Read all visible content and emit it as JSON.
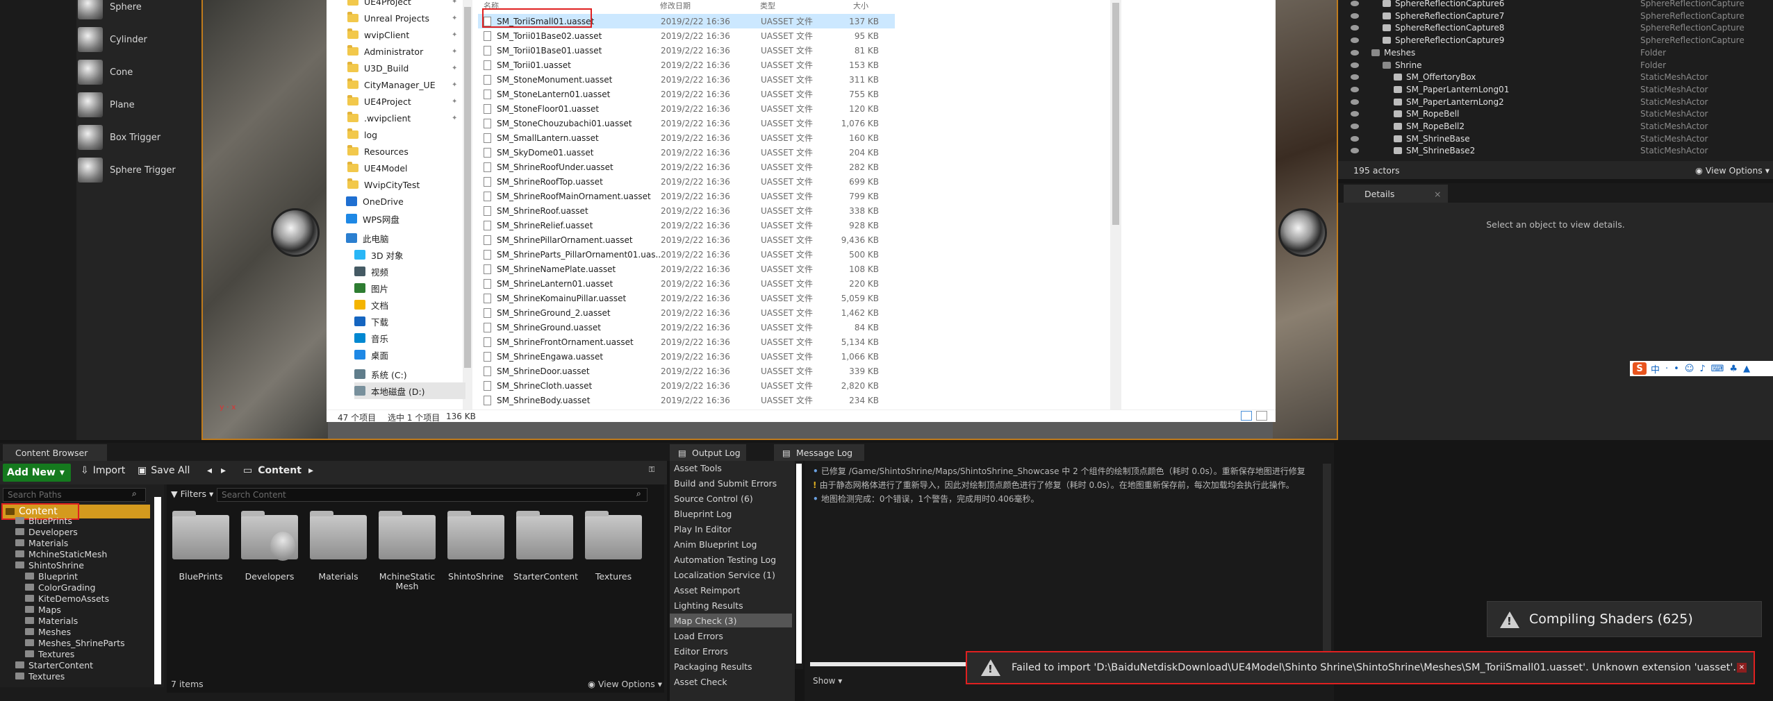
{
  "place_actors": {
    "items": [
      {
        "label": "Sphere",
        "icon": "sphere-icon"
      },
      {
        "label": "Cylinder",
        "icon": "cylinder-icon"
      },
      {
        "label": "Cone",
        "icon": "cone-icon"
      },
      {
        "label": "Plane",
        "icon": "plane-icon"
      },
      {
        "label": "Box Trigger",
        "icon": "box-trigger-icon"
      },
      {
        "label": "Sphere Trigger",
        "icon": "sphere-trigger-icon"
      }
    ]
  },
  "explorer": {
    "nav": [
      {
        "label": "UE4Project",
        "pin": true
      },
      {
        "label": "Unreal Projects",
        "pin": true
      },
      {
        "label": "wvipClient",
        "pin": true
      },
      {
        "label": "Administrator",
        "pin": true
      },
      {
        "label": "U3D_Build",
        "pin": true
      },
      {
        "label": "CityManager_UE",
        "pin": true
      },
      {
        "label": "UE4Project",
        "pin": true
      },
      {
        "label": ".wvipclient",
        "pin": true
      },
      {
        "label": "log",
        "pin": false
      },
      {
        "label": "Resources",
        "pin": false
      },
      {
        "label": "UE4Model",
        "pin": false
      },
      {
        "label": "WvipCityTest",
        "pin": false
      }
    ],
    "nav_special": [
      "OneDrive",
      "WPS网盘",
      "此电脑",
      "3D 对象",
      "视频",
      "图片",
      "文档",
      "下载",
      "音乐",
      "桌面",
      "系统 (C:)",
      "本地磁盘 (D:)"
    ],
    "headers": {
      "name": "名称",
      "date": "修改日期",
      "type": "类型",
      "size": "大小"
    },
    "files": [
      {
        "name": "SM_ToriiSmall01.uasset",
        "date": "2019/2/22 16:36",
        "type": "UASSET 文件",
        "size": "137 KB"
      },
      {
        "name": "SM_Torii01Base02.uasset",
        "date": "2019/2/22 16:36",
        "type": "UASSET 文件",
        "size": "95 KB"
      },
      {
        "name": "SM_Torii01Base01.uasset",
        "date": "2019/2/22 16:36",
        "type": "UASSET 文件",
        "size": "81 KB"
      },
      {
        "name": "SM_Torii01.uasset",
        "date": "2019/2/22 16:36",
        "type": "UASSET 文件",
        "size": "153 KB"
      },
      {
        "name": "SM_StoneMonument.uasset",
        "date": "2019/2/22 16:36",
        "type": "UASSET 文件",
        "size": "311 KB"
      },
      {
        "name": "SM_StoneLantern01.uasset",
        "date": "2019/2/22 16:36",
        "type": "UASSET 文件",
        "size": "755 KB"
      },
      {
        "name": "SM_StoneFloor01.uasset",
        "date": "2019/2/22 16:36",
        "type": "UASSET 文件",
        "size": "120 KB"
      },
      {
        "name": "SM_StoneChouzubachi01.uasset",
        "date": "2019/2/22 16:36",
        "type": "UASSET 文件",
        "size": "1,076 KB"
      },
      {
        "name": "SM_SmallLantern.uasset",
        "date": "2019/2/22 16:36",
        "type": "UASSET 文件",
        "size": "160 KB"
      },
      {
        "name": "SM_SkyDome01.uasset",
        "date": "2019/2/22 16:36",
        "type": "UASSET 文件",
        "size": "204 KB"
      },
      {
        "name": "SM_ShrineRoofUnder.uasset",
        "date": "2019/2/22 16:36",
        "type": "UASSET 文件",
        "size": "282 KB"
      },
      {
        "name": "SM_ShrineRoofTop.uasset",
        "date": "2019/2/22 16:36",
        "type": "UASSET 文件",
        "size": "699 KB"
      },
      {
        "name": "SM_ShrineRoofMainOrnament.uasset",
        "date": "2019/2/22 16:36",
        "type": "UASSET 文件",
        "size": "799 KB"
      },
      {
        "name": "SM_ShrineRoof.uasset",
        "date": "2019/2/22 16:36",
        "type": "UASSET 文件",
        "size": "338 KB"
      },
      {
        "name": "SM_ShrineRelief.uasset",
        "date": "2019/2/22 16:36",
        "type": "UASSET 文件",
        "size": "928 KB"
      },
      {
        "name": "SM_ShrinePillarOrnament.uasset",
        "date": "2019/2/22 16:36",
        "type": "UASSET 文件",
        "size": "9,436 KB"
      },
      {
        "name": "SM_ShrineParts_PillarOrnament01.uas...",
        "date": "2019/2/22 16:36",
        "type": "UASSET 文件",
        "size": "500 KB"
      },
      {
        "name": "SM_ShrineNamePlate.uasset",
        "date": "2019/2/22 16:36",
        "type": "UASSET 文件",
        "size": "108 KB"
      },
      {
        "name": "SM_ShrineLantern01.uasset",
        "date": "2019/2/22 16:36",
        "type": "UASSET 文件",
        "size": "220 KB"
      },
      {
        "name": "SM_ShrineKomainuPillar.uasset",
        "date": "2019/2/22 16:36",
        "type": "UASSET 文件",
        "size": "5,059 KB"
      },
      {
        "name": "SM_ShrineGround_2.uasset",
        "date": "2019/2/22 16:36",
        "type": "UASSET 文件",
        "size": "1,462 KB"
      },
      {
        "name": "SM_ShrineGround.uasset",
        "date": "2019/2/22 16:36",
        "type": "UASSET 文件",
        "size": "84 KB"
      },
      {
        "name": "SM_ShrineFrontOrnament.uasset",
        "date": "2019/2/22 16:36",
        "type": "UASSET 文件",
        "size": "5,134 KB"
      },
      {
        "name": "SM_ShrineEngawa.uasset",
        "date": "2019/2/22 16:36",
        "type": "UASSET 文件",
        "size": "1,066 KB"
      },
      {
        "name": "SM_ShrineDoor.uasset",
        "date": "2019/2/22 16:36",
        "type": "UASSET 文件",
        "size": "339 KB"
      },
      {
        "name": "SM_ShrineCloth.uasset",
        "date": "2019/2/22 16:36",
        "type": "UASSET 文件",
        "size": "2,820 KB"
      },
      {
        "name": "SM_ShrineBody.uasset",
        "date": "2019/2/22 16:36",
        "type": "UASSET 文件",
        "size": "234 KB"
      }
    ],
    "status": {
      "count": "47 个项目",
      "selected": "选中 1 个项目",
      "size": "136 KB"
    }
  },
  "outliner": {
    "rows": [
      {
        "name": "SphereReflectionCapture6",
        "type": "SphereReflectionCapture",
        "indent": 3
      },
      {
        "name": "SphereReflectionCapture7",
        "type": "SphereReflectionCapture",
        "indent": 3
      },
      {
        "name": "SphereReflectionCapture8",
        "type": "SphereReflectionCapture",
        "indent": 3
      },
      {
        "name": "SphereReflectionCapture9",
        "type": "SphereReflectionCapture",
        "indent": 3
      },
      {
        "name": "Meshes",
        "type": "Folder",
        "indent": 2
      },
      {
        "name": "Shrine",
        "type": "Folder",
        "indent": 3
      },
      {
        "name": "SM_OffertoryBox",
        "type": "StaticMeshActor",
        "indent": 4
      },
      {
        "name": "SM_PaperLanternLong01",
        "type": "StaticMeshActor",
        "indent": 4
      },
      {
        "name": "SM_PaperLanternLong2",
        "type": "StaticMeshActor",
        "indent": 4
      },
      {
        "name": "SM_RopeBell",
        "type": "StaticMeshActor",
        "indent": 4
      },
      {
        "name": "SM_RopeBell2",
        "type": "StaticMeshActor",
        "indent": 4
      },
      {
        "name": "SM_ShrineBase",
        "type": "StaticMeshActor",
        "indent": 4
      },
      {
        "name": "SM_ShrineBase2",
        "type": "StaticMeshActor",
        "indent": 4
      }
    ],
    "actor_count": "195 actors",
    "view_options": "View Options"
  },
  "details": {
    "tab": "Details",
    "empty_text": "Select an object to view details."
  },
  "content_browser": {
    "tab": "Content Browser",
    "add_new": "Add New",
    "import": "Import",
    "save_all": "Save All",
    "breadcrumb": "Content",
    "search_paths": "Search Paths",
    "filters": "Filters",
    "search_content": "Search Content",
    "tree": [
      {
        "label": "Content",
        "level": 0
      },
      {
        "label": "BluePrints",
        "level": 1
      },
      {
        "label": "Developers",
        "level": 1
      },
      {
        "label": "Materials",
        "level": 1
      },
      {
        "label": "MchineStaticMesh",
        "level": 1
      },
      {
        "label": "ShintoShrine",
        "level": 1
      },
      {
        "label": "Blueprint",
        "level": 2
      },
      {
        "label": "ColorGrading",
        "level": 2
      },
      {
        "label": "KiteDemoAssets",
        "level": 2
      },
      {
        "label": "Maps",
        "level": 2
      },
      {
        "label": "Materials",
        "level": 2
      },
      {
        "label": "Meshes",
        "level": 2
      },
      {
        "label": "Meshes_ShrineParts",
        "level": 2
      },
      {
        "label": "Textures",
        "level": 2
      },
      {
        "label": "StarterContent",
        "level": 1
      },
      {
        "label": "Textures",
        "level": 1
      }
    ],
    "assets": [
      "BluePrints",
      "Developers",
      "Materials",
      "MchineStatic\nMesh",
      "ShintoShrine",
      "StarterContent",
      "Textures"
    ],
    "item_count": "7 items",
    "view_options": "View Options"
  },
  "log": {
    "tabs": [
      "Output Log",
      "Message Log"
    ],
    "categories": [
      "Asset Tools",
      "Build and Submit Errors",
      "Source Control (6)",
      "Blueprint Log",
      "Play In Editor",
      "Anim Blueprint Log",
      "Automation Testing Log",
      "Localization Service (1)",
      "Asset Reimport",
      "Lighting Results",
      "Map Check (3)",
      "Load Errors",
      "Editor Errors",
      "Packaging Results",
      "Asset Check"
    ],
    "selected_category": "Map Check (3)",
    "lines": [
      {
        "level": "info",
        "text": "已修复 /Game/ShintoShrine/Maps/ShintoShrine_Showcase 中 2 个组件的绘制顶点颜色（耗时 0.0s）。重新保存地图进行修复"
      },
      {
        "level": "warning",
        "text": "由于静态网格体进行了重新导入，因此对绘制顶点颜色进行了修复（耗时 0.0s）。在地图重新保存前，每次加载均会执行此操作。"
      },
      {
        "level": "info",
        "text": "地图检测完成：0个错误，1个警告，完成用时0.406毫秒。"
      }
    ],
    "show": "Show"
  },
  "notifications": {
    "compiling": "Compiling Shaders (625)",
    "failed": "Failed to import 'D:\\BaiduNetdiskDownload\\UE4Model\\Shinto Shrine\\ShintoShrine\\Meshes\\SM_ToriiSmall01.uasset'. Unknown extension 'uasset'."
  },
  "ime": {
    "label": "中"
  },
  "colors": {
    "accent": "#d49a1e",
    "highlight": "#e02020",
    "selection": "#cce8ff",
    "add_new": "#157a1e"
  }
}
